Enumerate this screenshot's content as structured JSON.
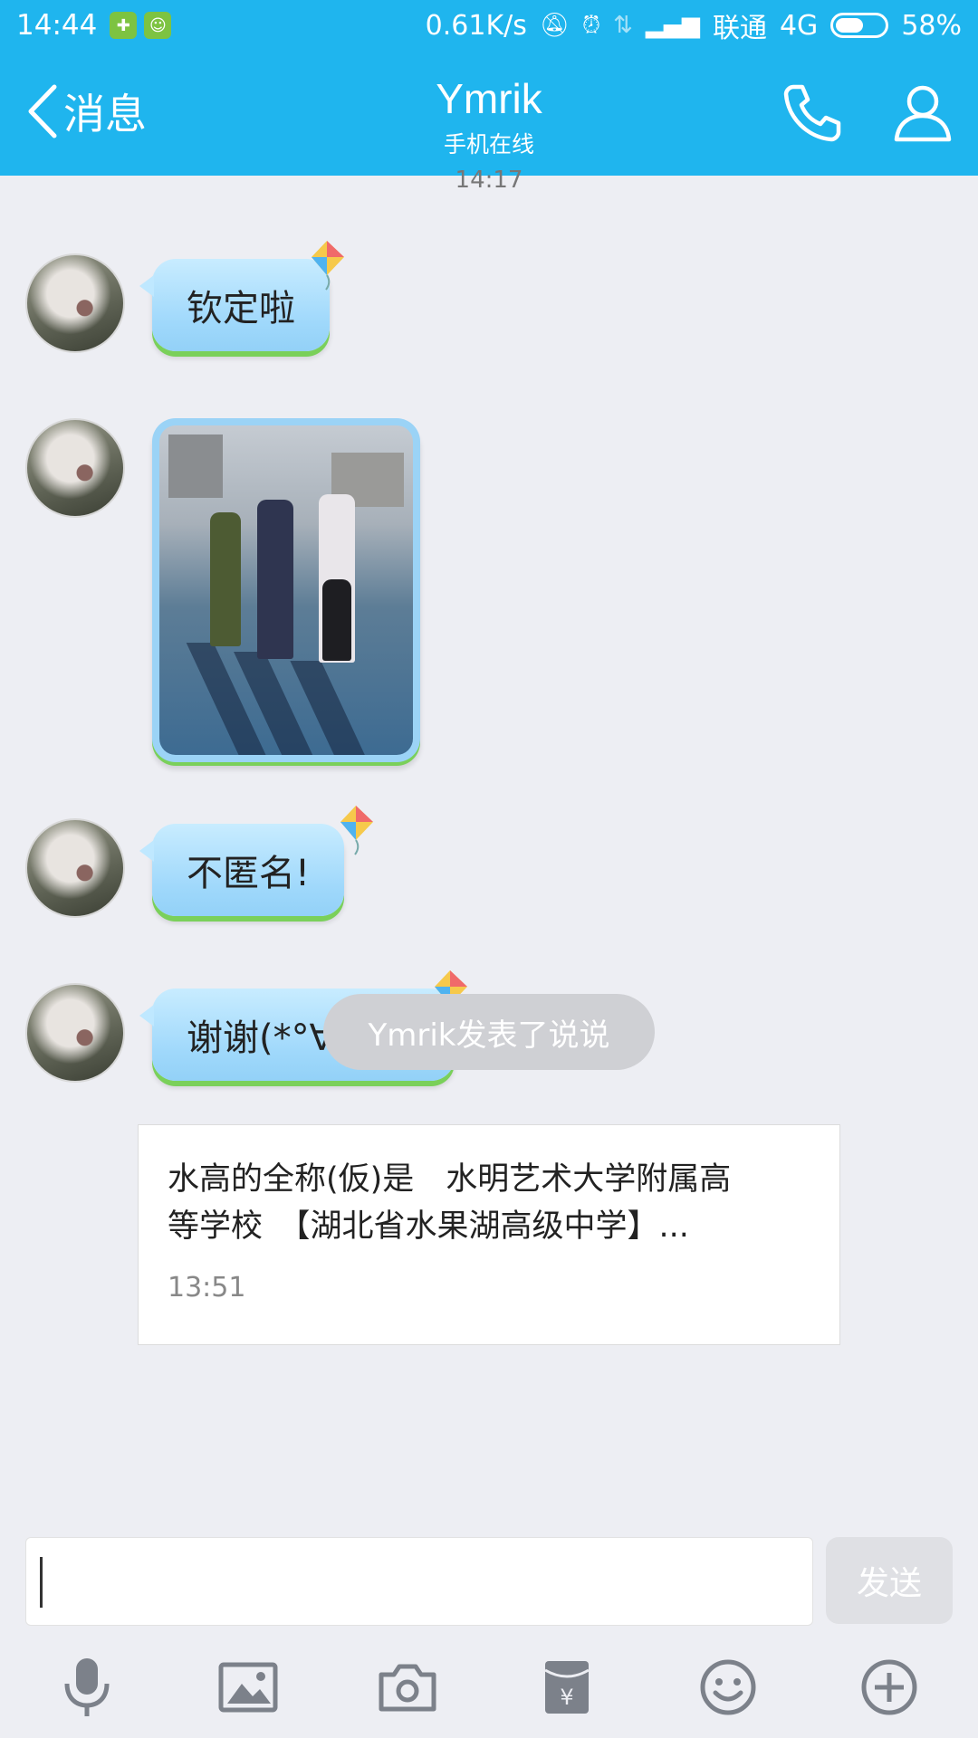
{
  "status_bar": {
    "time": "14:44",
    "speed": "0.61K/s",
    "carrier": "联通",
    "network": "4G",
    "battery": "58%",
    "battery_level": 0.58
  },
  "header": {
    "back_label": "消息",
    "title": "Ymrik",
    "subtitle": "手机在线",
    "icons": [
      "back-chevron-icon",
      "phone-icon",
      "user-icon"
    ]
  },
  "chat": {
    "timestamp": "14:17",
    "messages": [
      {
        "type": "text",
        "text": "钦定啦"
      },
      {
        "type": "image"
      },
      {
        "type": "text",
        "text": "不匿名!"
      },
      {
        "type": "text",
        "text": "谢谢(*°∀°)=3"
      }
    ],
    "system_notice": "Ymrik发表了说说",
    "shared_post": {
      "line1": "水高的全称(仮)是　水明艺术大学附属高",
      "line2": "等学校　【湖北省水果湖高级中学】...",
      "time": "13:51"
    }
  },
  "input": {
    "value": "",
    "send_label": "发送"
  },
  "toolbar": {
    "items": [
      "microphone-icon",
      "image-icon",
      "camera-icon",
      "red-packet-icon",
      "emoji-icon",
      "plus-icon"
    ]
  },
  "colors": {
    "accent": "#1fb5ee",
    "bubble": "#a8dcfb",
    "bubble_grass": "#7ad05a",
    "background": "#edeef3"
  }
}
